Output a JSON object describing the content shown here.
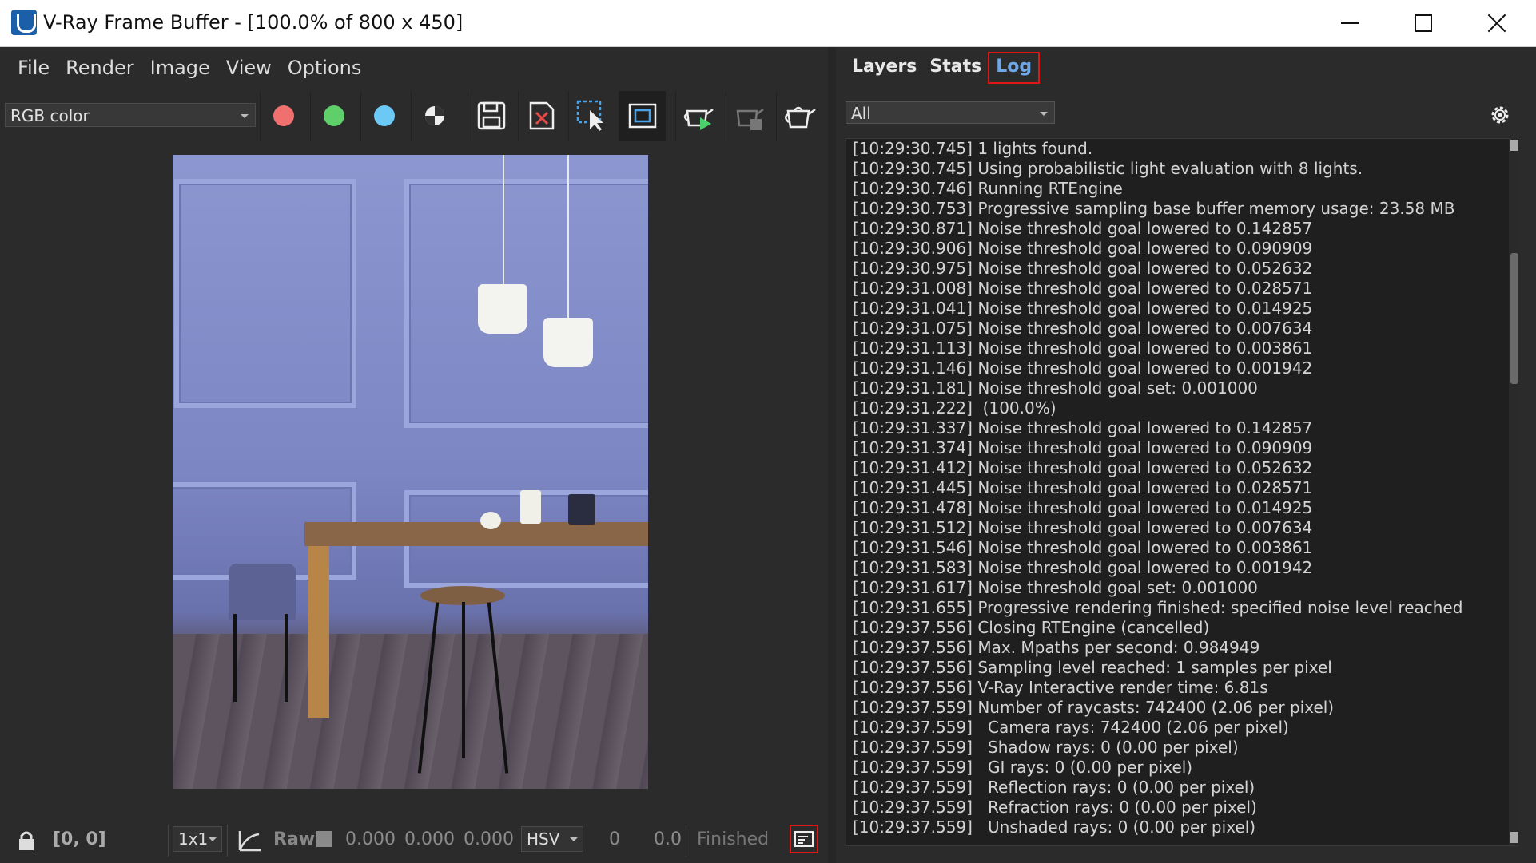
{
  "window": {
    "title": "V-Ray Frame Buffer - [100.0% of 800 x 450]"
  },
  "menu": [
    "File",
    "Render",
    "Image",
    "View",
    "Options"
  ],
  "toolbar": {
    "channel": "RGB color",
    "colors": {
      "red": "#f07070",
      "green": "#5fcf6a",
      "blue": "#6cc8f5"
    }
  },
  "status": {
    "coords": "[0, 0]",
    "ratio": "1x1",
    "raw_label": "Raw",
    "r": "0.000",
    "g": "0.000",
    "b": "0.000",
    "color_mode": "HSV",
    "v1": "0",
    "v2": "0.0",
    "state": "Finished"
  },
  "tabs": [
    "Layers",
    "Stats",
    "Log"
  ],
  "active_tab": "Log",
  "log": {
    "filter": "All",
    "lines": [
      "[10:29:30.745] 1 lights found.",
      "[10:29:30.745] Using probabilistic light evaluation with 8 lights.",
      "[10:29:30.746] Running RTEngine",
      "[10:29:30.753] Progressive sampling base buffer memory usage: 23.58 MB",
      "[10:29:30.871] Noise threshold goal lowered to 0.142857",
      "[10:29:30.906] Noise threshold goal lowered to 0.090909",
      "[10:29:30.975] Noise threshold goal lowered to 0.052632",
      "[10:29:31.008] Noise threshold goal lowered to 0.028571",
      "[10:29:31.041] Noise threshold goal lowered to 0.014925",
      "[10:29:31.075] Noise threshold goal lowered to 0.007634",
      "[10:29:31.113] Noise threshold goal lowered to 0.003861",
      "[10:29:31.146] Noise threshold goal lowered to 0.001942",
      "[10:29:31.181] Noise threshold goal set: 0.001000",
      "[10:29:31.222]  (100.0%)",
      "[10:29:31.337] Noise threshold goal lowered to 0.142857",
      "[10:29:31.374] Noise threshold goal lowered to 0.090909",
      "[10:29:31.412] Noise threshold goal lowered to 0.052632",
      "[10:29:31.445] Noise threshold goal lowered to 0.028571",
      "[10:29:31.478] Noise threshold goal lowered to 0.014925",
      "[10:29:31.512] Noise threshold goal lowered to 0.007634",
      "[10:29:31.546] Noise threshold goal lowered to 0.003861",
      "[10:29:31.583] Noise threshold goal lowered to 0.001942",
      "[10:29:31.617] Noise threshold goal set: 0.001000",
      "[10:29:31.655] Progressive rendering finished: specified noise level reached",
      "[10:29:37.556] Closing RTEngine (cancelled)",
      "[10:29:37.556] Max. Mpaths per second: 0.984949",
      "[10:29:37.556] Sampling level reached: 1 samples per pixel",
      "[10:29:37.556] V-Ray Interactive render time: 6.81s",
      "[10:29:37.559] Number of raycasts: 742400 (2.06 per pixel)",
      "[10:29:37.559]   Camera rays: 742400 (2.06 per pixel)",
      "[10:29:37.559]   Shadow rays: 0 (0.00 per pixel)",
      "[10:29:37.559]   GI rays: 0 (0.00 per pixel)",
      "[10:29:37.559]   Reflection rays: 0 (0.00 per pixel)",
      "[10:29:37.559]   Refraction rays: 0 (0.00 per pixel)",
      "[10:29:37.559]   Unshaded rays: 0 (0.00 per pixel)"
    ]
  }
}
